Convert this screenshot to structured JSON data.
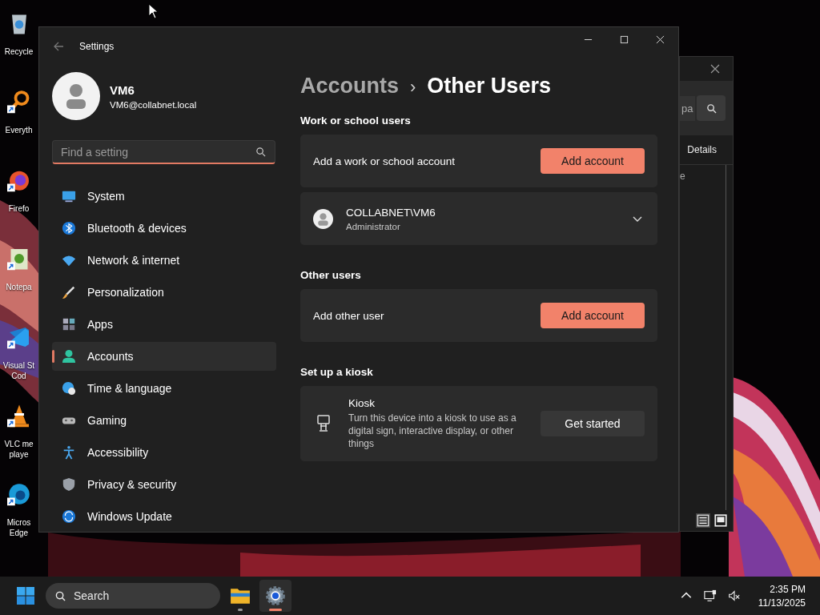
{
  "desktop_icons": [
    {
      "lines": [
        "Recycle"
      ],
      "shortcut": false
    },
    {
      "lines": [
        "Everyth"
      ],
      "shortcut": true
    },
    {
      "lines": [
        "Firefo"
      ],
      "shortcut": true
    },
    {
      "lines": [
        "Notepa"
      ],
      "shortcut": true
    },
    {
      "lines": [
        "Visual St",
        "Cod"
      ],
      "shortcut": true
    },
    {
      "lines": [
        "VLC me",
        "playe"
      ],
      "shortcut": true
    },
    {
      "lines": [
        "Micros",
        "Edge"
      ],
      "shortcut": true
    }
  ],
  "background_window": {
    "search_text": "pa",
    "tab": "Details",
    "column_3": "e"
  },
  "settings_window": {
    "title": "Settings",
    "user": {
      "name": "VM6",
      "email": "VM6@collabnet.local"
    },
    "search": {
      "placeholder": "Find a setting"
    },
    "nav_items": [
      {
        "label": "System",
        "selected": false
      },
      {
        "label": "Bluetooth & devices",
        "selected": false
      },
      {
        "label": "Network & internet",
        "selected": false
      },
      {
        "label": "Personalization",
        "selected": false
      },
      {
        "label": "Apps",
        "selected": false
      },
      {
        "label": "Accounts",
        "selected": true
      },
      {
        "label": "Time & language",
        "selected": false
      },
      {
        "label": "Gaming",
        "selected": false
      },
      {
        "label": "Accessibility",
        "selected": false
      },
      {
        "label": "Privacy & security",
        "selected": false
      },
      {
        "label": "Windows Update",
        "selected": false
      }
    ],
    "breadcrumb": {
      "parent": "Accounts",
      "separator": "›",
      "current": "Other Users"
    },
    "sections": [
      {
        "heading": "Work or school users",
        "cards": [
          {
            "kind": "action",
            "label": "Add a work or school account",
            "button": "Add account",
            "accent": true
          },
          {
            "kind": "user",
            "name": "COLLABNET\\VM6",
            "role": "Administrator",
            "expanded": false
          }
        ]
      },
      {
        "heading": "Other users",
        "cards": [
          {
            "kind": "action",
            "label": "Add other user",
            "button": "Add account",
            "accent": true
          }
        ]
      },
      {
        "heading": "Set up a kiosk",
        "cards": [
          {
            "kind": "kiosk",
            "title": "Kiosk",
            "description": "Turn this device into a kiosk to use as a digital sign, interactive display, or other things",
            "button": "Get started",
            "accent": false
          }
        ]
      }
    ]
  },
  "taskbar": {
    "search": {
      "placeholder": "Search"
    },
    "apps": [
      {
        "selected": false
      },
      {
        "selected": true
      }
    ],
    "clock": {
      "time": "2:35 PM",
      "date": "11/13/2025"
    }
  }
}
